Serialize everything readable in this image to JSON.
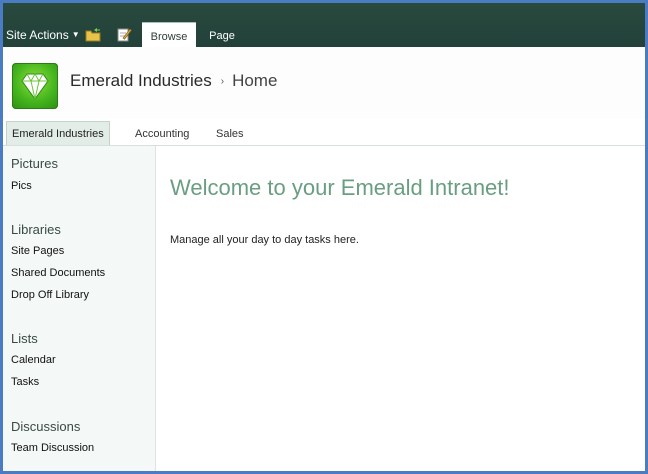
{
  "ribbon": {
    "site_actions_label": "Site Actions",
    "tabs": [
      {
        "label": "Browse",
        "selected": true
      },
      {
        "label": "Page",
        "selected": false
      }
    ],
    "icons": [
      "navigate-up-icon",
      "edit-page-icon"
    ]
  },
  "header": {
    "site_title": "Emerald Industries",
    "breadcrumb_separator": "›",
    "current_page": "Home",
    "logo_icon": "diamond-icon"
  },
  "topnav": {
    "items": [
      {
        "label": "Emerald Industries",
        "selected": true
      },
      {
        "label": "Accounting",
        "selected": false
      },
      {
        "label": "Sales",
        "selected": false
      }
    ]
  },
  "quicklaunch": {
    "sections": [
      {
        "heading": "Pictures",
        "links": [
          "Pics"
        ]
      },
      {
        "heading": "Libraries",
        "links": [
          "Site Pages",
          "Shared Documents",
          "Drop Off Library"
        ]
      },
      {
        "heading": "Lists",
        "links": [
          "Calendar",
          "Tasks"
        ]
      },
      {
        "heading": "Discussions",
        "links": [
          "Team Discussion"
        ]
      }
    ]
  },
  "content": {
    "welcome_heading": "Welcome to your Emerald Intranet!",
    "body_text": "Manage all your day to day tasks here."
  },
  "colors": {
    "ribbon_bg": "#24443b",
    "accent_green": "#6a9e82",
    "window_border": "#4a7cc4"
  }
}
